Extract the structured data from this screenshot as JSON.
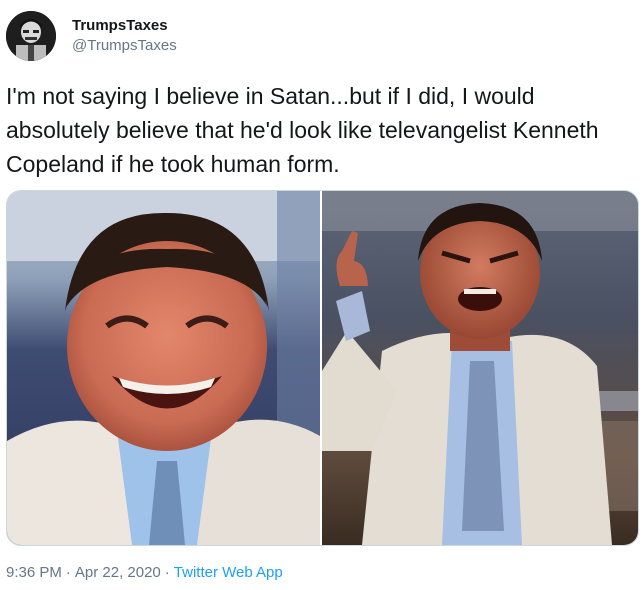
{
  "author": {
    "display_name": "TrumpsTaxes",
    "handle": "@TrumpsTaxes",
    "avatar_icon": "profile-photo-icon"
  },
  "tweet": {
    "text": "I'm not saying I believe in Satan...but if I did, I would absolutely believe that he'd look like televangelist Kenneth Copeland if he took human form.",
    "time": "9:36 PM",
    "separator_1": "·",
    "date": "Apr 22, 2020",
    "separator_2": "·",
    "source": "Twitter Web App"
  },
  "colors": {
    "text": "#14171a",
    "secondary": "#657786",
    "link": "#1da1f2",
    "border": "#ccd6dd"
  }
}
